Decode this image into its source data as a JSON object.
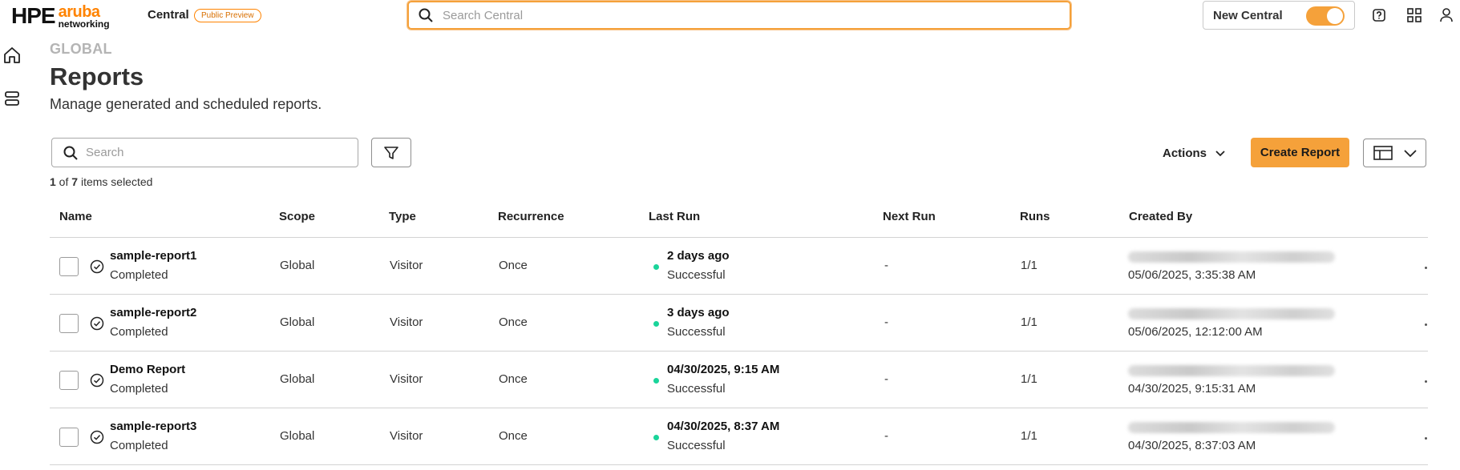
{
  "brand": {
    "hpe": "HPE",
    "aruba": "aruba",
    "networking": "networking"
  },
  "app": {
    "name": "Central",
    "badge": "Public Preview"
  },
  "global_search": {
    "placeholder": "Search Central",
    "value": ""
  },
  "new_central": {
    "label": "New Central",
    "enabled": true
  },
  "top_icons": [
    "help-icon",
    "app-grid-icon",
    "user-icon"
  ],
  "rail_icons": [
    "home-icon",
    "devices-icon"
  ],
  "page": {
    "eyebrow": "GLOBAL",
    "title": "Reports",
    "subtitle": "Manage generated and scheduled reports."
  },
  "toolbar": {
    "search_placeholder": "Search",
    "selected_count": "1",
    "of_text": " of ",
    "total_count": "7",
    "items_selected_text": " items selected",
    "actions_label": "Actions",
    "create_label": "Create Report"
  },
  "table": {
    "columns": {
      "name": "Name",
      "scope": "Scope",
      "type": "Type",
      "recurrence": "Recurrence",
      "last_run": "Last Run",
      "next_run": "Next Run",
      "runs": "Runs",
      "created_by": "Created By"
    },
    "rows": [
      {
        "name": "sample-report1",
        "status": "Completed",
        "scope": "Global",
        "type": "Visitor",
        "recurrence": "Once",
        "last_run": "2 days ago",
        "last_run_status": "Successful",
        "next_run": "-",
        "runs": "1/1",
        "created_date": "05/06/2025, 3:35:38 AM"
      },
      {
        "name": "sample-report2",
        "status": "Completed",
        "scope": "Global",
        "type": "Visitor",
        "recurrence": "Once",
        "last_run": "3 days ago",
        "last_run_status": "Successful",
        "next_run": "-",
        "runs": "1/1",
        "created_date": "05/06/2025, 12:12:00 AM"
      },
      {
        "name": "Demo Report",
        "status": "Completed",
        "scope": "Global",
        "type": "Visitor",
        "recurrence": "Once",
        "last_run": "04/30/2025, 9:15 AM",
        "last_run_status": "Successful",
        "next_run": "-",
        "runs": "1/1",
        "created_date": "04/30/2025, 9:15:31 AM"
      },
      {
        "name": "sample-report3",
        "status": "Completed",
        "scope": "Global",
        "type": "Visitor",
        "recurrence": "Once",
        "last_run": "04/30/2025, 8:37 AM",
        "last_run_status": "Successful",
        "next_run": "-",
        "runs": "1/1",
        "created_date": "04/30/2025, 8:37:03 AM"
      }
    ]
  },
  "colors": {
    "accent": "#f5a13a",
    "success": "#1ad49a",
    "badge": "#ff8300"
  }
}
